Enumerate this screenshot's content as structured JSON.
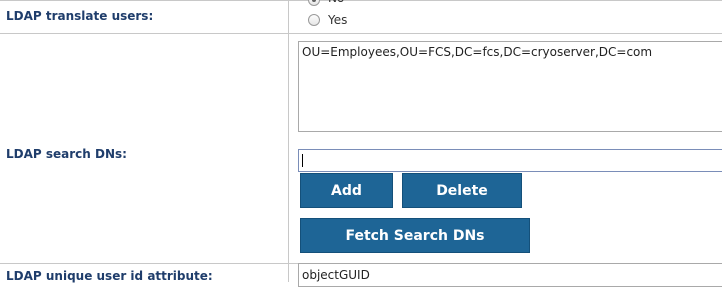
{
  "translate_users": {
    "label": "LDAP translate users:",
    "options": [
      {
        "label": "No",
        "selected": true
      },
      {
        "label": "Yes",
        "selected": false
      }
    ]
  },
  "search_dns": {
    "label": "LDAP search DNs:",
    "list_value": "OU=Employees,OU=FCS,DC=fcs,DC=cryoserver,DC=com",
    "input_value": "",
    "add_label": "Add",
    "delete_label": "Delete",
    "fetch_label": "Fetch Search DNs"
  },
  "unique_user_id": {
    "label": "LDAP unique user id attribute:",
    "value": "objectGUID"
  },
  "colors": {
    "button_bg": "#1e6596",
    "label_text": "#1f3d6b",
    "border": "#c8c8c8"
  }
}
